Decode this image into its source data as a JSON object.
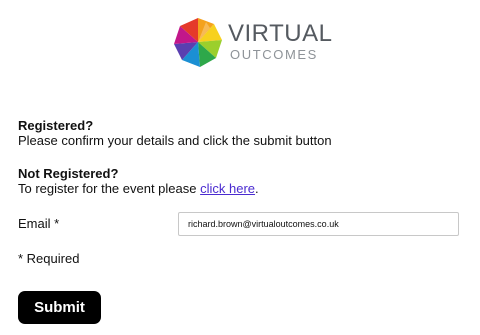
{
  "logo": {
    "line1": "VIRTUAL",
    "line2": "OUTCOMES"
  },
  "registered": {
    "heading": "Registered?",
    "text": "Please confirm your details and click the submit button"
  },
  "not_registered": {
    "heading": "Not Registered?",
    "text_before_link": "To register for the event please ",
    "link_text": "click here",
    "text_after_link": "."
  },
  "email": {
    "label": "Email *",
    "value": "richard.brown@virtualoutcomes.co.uk"
  },
  "required_note": "* Required",
  "submit_label": "Submit",
  "colors": {
    "link": "#4a2bd0",
    "button_bg": "#000000",
    "button_text": "#ffffff"
  }
}
